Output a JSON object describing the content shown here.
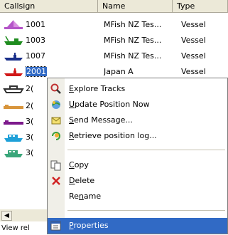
{
  "columns": [
    "Callsign",
    "Name",
    "Type"
  ],
  "rows": [
    {
      "callsign": "1001",
      "name": "MFish NZ Tes...",
      "type": "Vessel",
      "icon": "sailboat-icon",
      "color": "#b455c8"
    },
    {
      "callsign": "1003",
      "name": "MFish NZ Tes...",
      "type": "Vessel",
      "icon": "fishing-vessel-icon",
      "color": "#1e8c1e"
    },
    {
      "callsign": "1007",
      "name": "MFish NZ Tes...",
      "type": "Vessel",
      "icon": "ship-icon",
      "color": "#1a2f8a"
    },
    {
      "callsign": "2001",
      "name": "Japan A",
      "type": "Vessel",
      "icon": "ship-icon",
      "color": "#d11818",
      "selected": true
    },
    {
      "callsign": "2(",
      "name": "",
      "type": "",
      "icon": "ship-outline-icon",
      "color": "#303030"
    },
    {
      "callsign": "2(",
      "name": "",
      "type": "",
      "icon": "longliner-icon",
      "color": "#d8953c"
    },
    {
      "callsign": "3(",
      "name": "",
      "type": "",
      "icon": "longliner-icon",
      "color": "#7d1a8c"
    },
    {
      "callsign": "3(",
      "name": "",
      "type": "",
      "icon": "trawler-icon",
      "color": "#1ea0d8"
    },
    {
      "callsign": "3(",
      "name": "",
      "type": "",
      "icon": "trawler-icon",
      "color": "#3aa67a"
    }
  ],
  "status_text": "View rel",
  "menu": {
    "items": [
      {
        "pre": "",
        "key": "E",
        "post": "xplore Tracks",
        "icon": "explore-tracks-icon"
      },
      {
        "pre": "",
        "key": "U",
        "post": "pdate Position Now",
        "icon": "update-position-icon"
      },
      {
        "pre": "",
        "key": "S",
        "post": "end Message...",
        "icon": "send-message-icon"
      },
      {
        "pre": "",
        "key": "R",
        "post": "etrieve position log...",
        "icon": "retrieve-log-icon"
      },
      {
        "pre": "",
        "key": "C",
        "post": "opy",
        "icon": "copy-icon"
      },
      {
        "pre": "",
        "key": "D",
        "post": "elete",
        "icon": "delete-icon"
      },
      {
        "pre": "Re",
        "key": "n",
        "post": "ame",
        "icon": ""
      },
      {
        "pre": "",
        "key": "P",
        "post": "roperties",
        "icon": "properties-icon",
        "hot": true
      }
    ]
  }
}
